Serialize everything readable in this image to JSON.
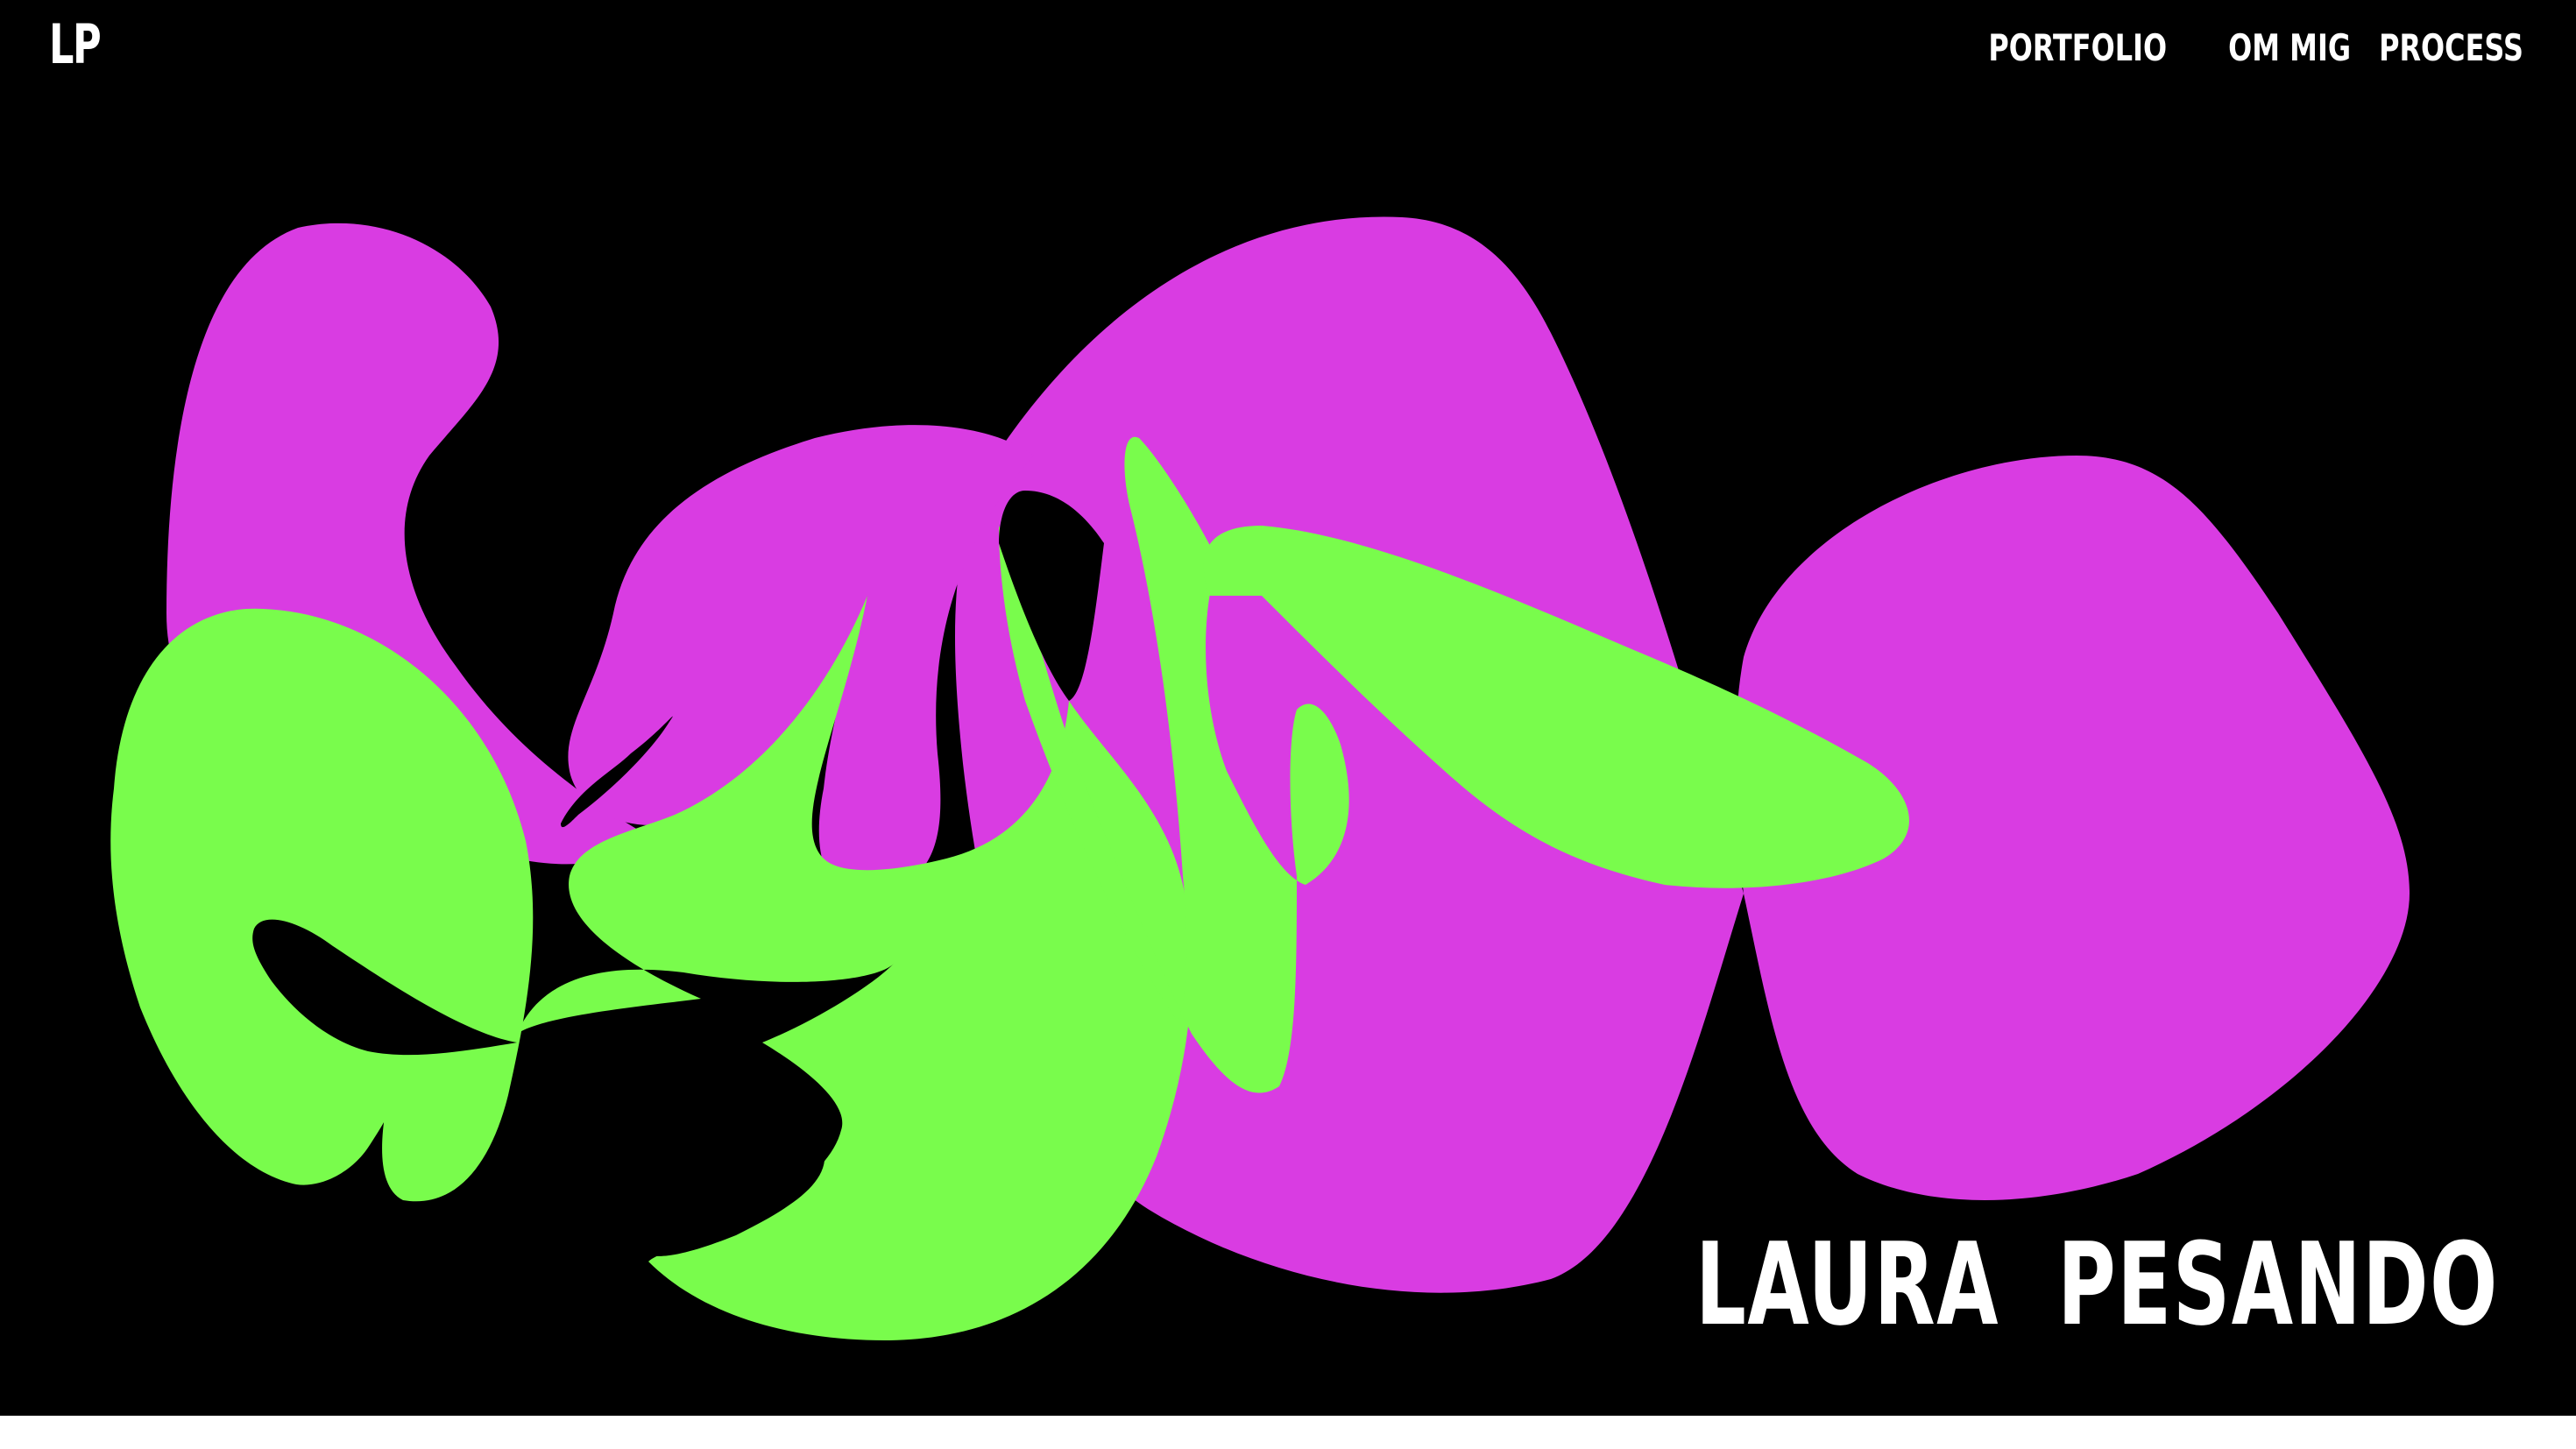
{
  "logo": {
    "text": "LP"
  },
  "nav": {
    "items": [
      {
        "label": "PORTFOLIO"
      },
      {
        "label": "OM MIG"
      },
      {
        "label": "PROCESS"
      }
    ]
  },
  "hero": {
    "title": "LAURA  PESANDO",
    "background_color": "#000000",
    "shape_colors": {
      "magenta": "#D93CE2",
      "green": "#79FC4C"
    }
  }
}
